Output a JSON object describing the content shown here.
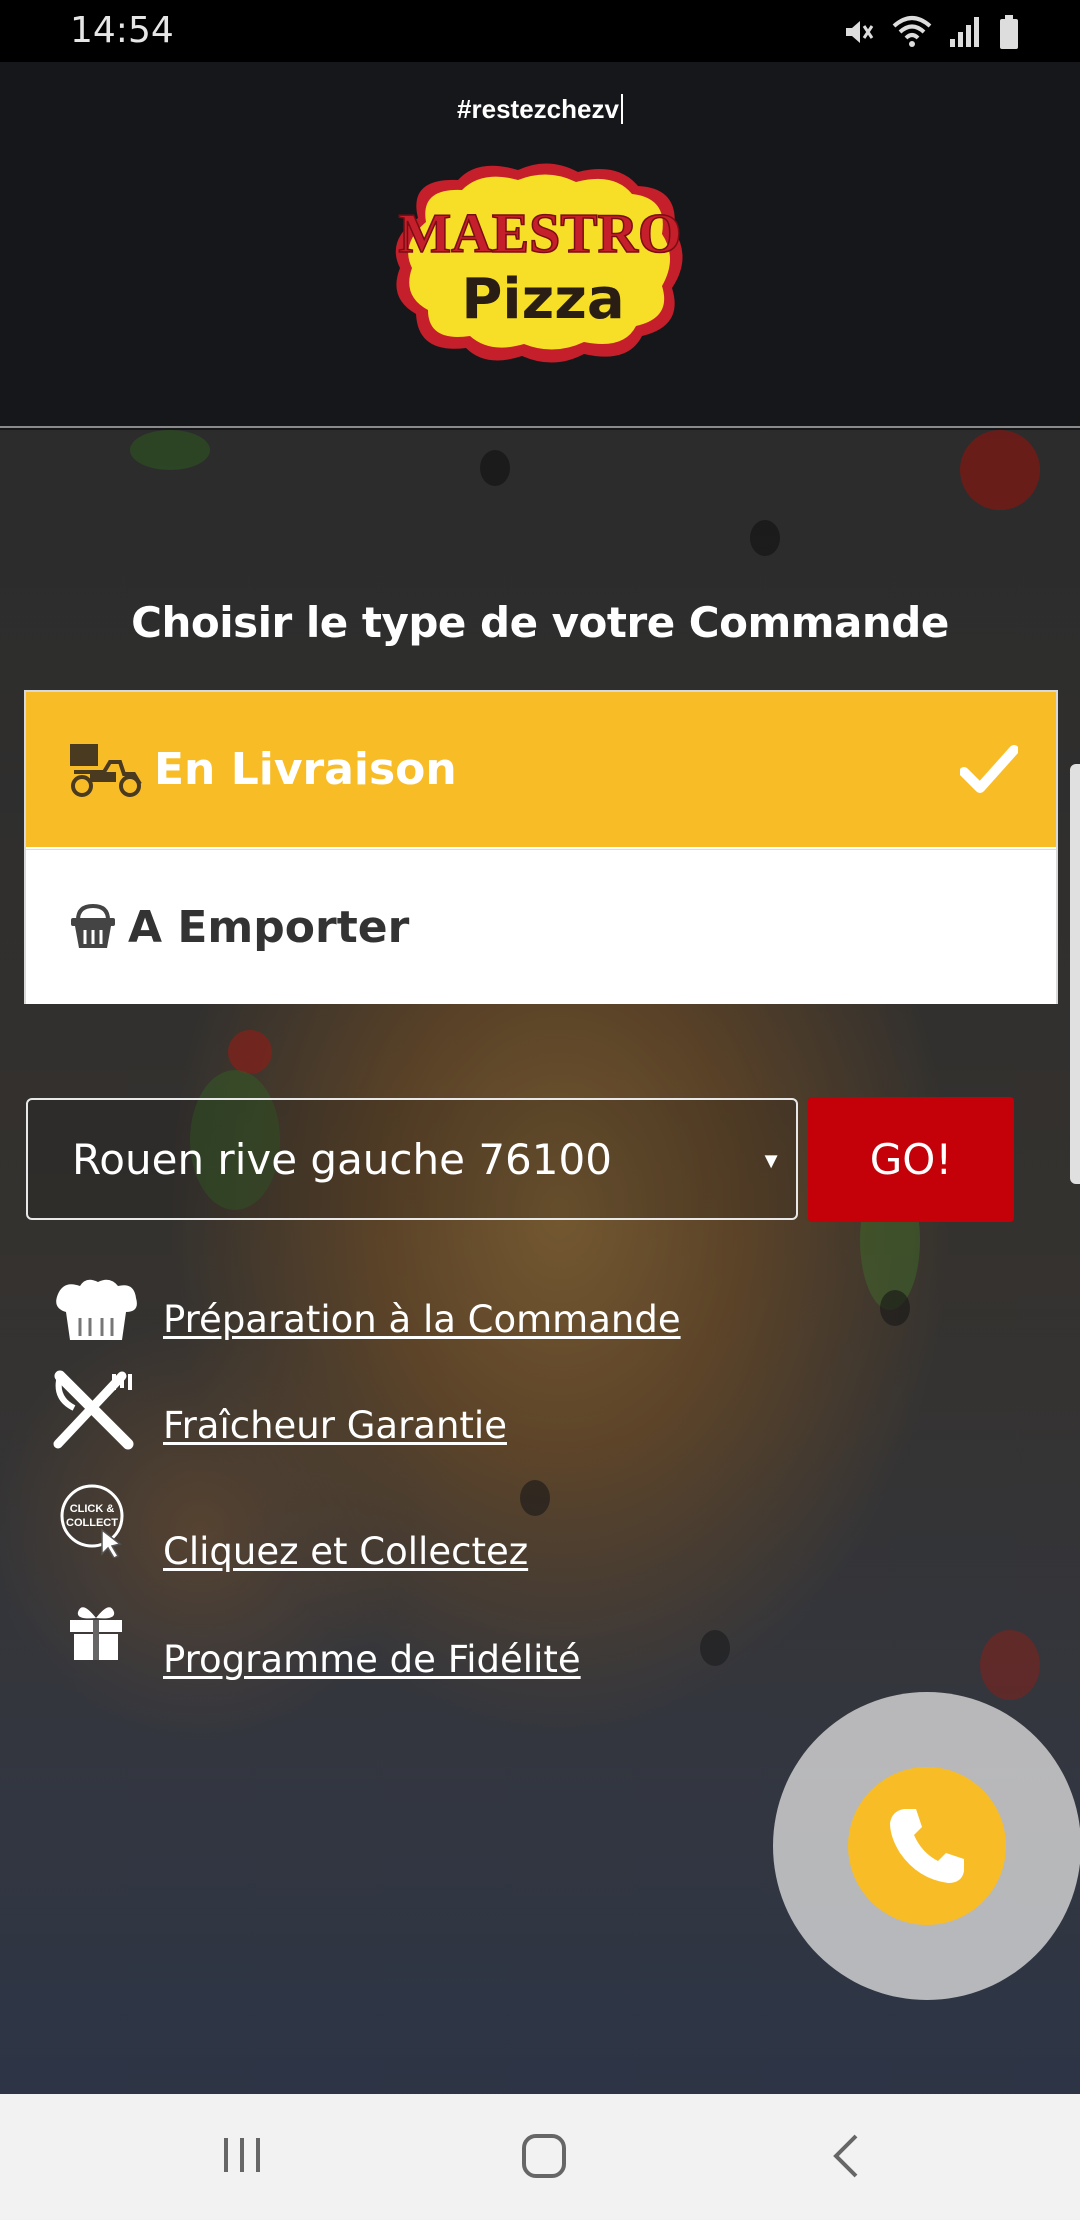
{
  "status_bar": {
    "time": "14:54",
    "icons": [
      "mute-icon",
      "wifi-icon",
      "signal-icon",
      "battery-icon"
    ]
  },
  "header": {
    "hashtag": "#restezchezv",
    "logo": {
      "line1": "MAESTRO",
      "line2": "Pizza"
    }
  },
  "order": {
    "title": "Choisir le type de votre Commande",
    "options": [
      {
        "label": "En Livraison",
        "icon": "delivery-scooter-icon",
        "selected": true
      },
      {
        "label": "A Emporter",
        "icon": "basket-icon",
        "selected": false
      }
    ]
  },
  "location": {
    "selected_city": "Rouen rive gauche 76100",
    "go_label": "GO!"
  },
  "features": [
    {
      "label": "Préparation à la Commande",
      "icon": "chef-hat-icon"
    },
    {
      "label": "Fraîcheur Garantie",
      "icon": "fork-knife-icon"
    },
    {
      "label": "Cliquez et Collectez",
      "icon": "click-collect-icon"
    },
    {
      "label": "Programme de Fidélité",
      "icon": "gift-icon"
    }
  ],
  "call_button": {
    "icon": "phone-icon"
  },
  "nav": [
    "recents-icon",
    "home-icon",
    "back-icon"
  ],
  "colors": {
    "accent_yellow": "#f8bd26",
    "go_red": "#c40008",
    "header_bg": "#16171a"
  }
}
